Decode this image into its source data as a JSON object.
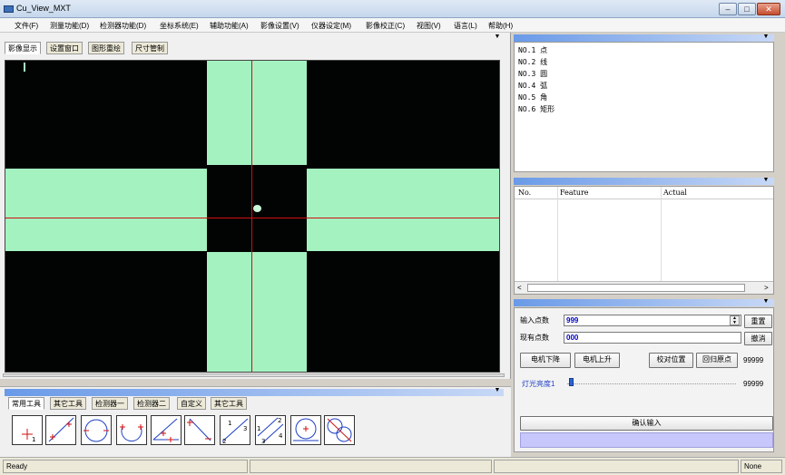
{
  "window": {
    "title": "Cu_View_MXT",
    "min": "–",
    "max": "□",
    "close": "✕"
  },
  "menu": [
    "文件(F)",
    "测量功能(D)",
    "检测器功能(D)",
    "坐标系统(E)",
    "辅助功能(A)",
    "影像设置(V)",
    "仪器设定(M)",
    "影像校正(C)",
    "视图(V)",
    "语言(L)",
    "帮助(H)"
  ],
  "video_tabs": [
    "影像显示",
    "设置窗口",
    "图形重绘",
    "尺寸管制"
  ],
  "tool_tabs": [
    "常用工具",
    "其它工具",
    "检测器一",
    "检测器二",
    "自定义",
    "其它工具"
  ],
  "tools": [
    "point-tool-icon",
    "line-tool-icon",
    "circle-tool-icon",
    "arc-tool-icon",
    "angle-tool-icon",
    "distance-tool-icon",
    "three-point-line-icon",
    "four-point-line-icon",
    "circle-tangent-icon",
    "two-circle-icon"
  ],
  "tool_labels": {
    "t1": "1",
    "t3a": "1",
    "t3b": "2",
    "t3c": "3",
    "t4a": "1",
    "t4b": "2",
    "t4c": "3",
    "t4d": "4"
  },
  "tree": [
    "NO.1 点",
    "NO.2 线",
    "NO.3 圆",
    "NO.4 弧",
    "NO.5 角",
    "NO.6 矩形"
  ],
  "table": {
    "headers": [
      "No.",
      "Feature",
      "Actual"
    ]
  },
  "controls": {
    "input_points_label": "输入点数",
    "input_points_value": "999",
    "existing_points_label": "现有点数",
    "existing_points_value": "000",
    "reset": "重置",
    "cancel": "撤消",
    "motor_down": "电机下降",
    "motor_up": "电机上升",
    "calibrate": "校对位置",
    "home": "回归原点",
    "counter1": "99999",
    "light_label": "灯光亮度1",
    "counter2": "99999",
    "confirm": "确认输入"
  },
  "status": {
    "ready": "Ready",
    "right": "None"
  },
  "arrows": {
    "down": "▼",
    "spin_up": "▲",
    "spin_down": "▼",
    "left": "<",
    "right": ">"
  },
  "colors": {
    "accent": "#6a9ae8",
    "video_band": "#a3f2c0",
    "crosshair": "#d01010",
    "tool_red": "#d01010",
    "tool_blue": "#1d3fc4"
  }
}
